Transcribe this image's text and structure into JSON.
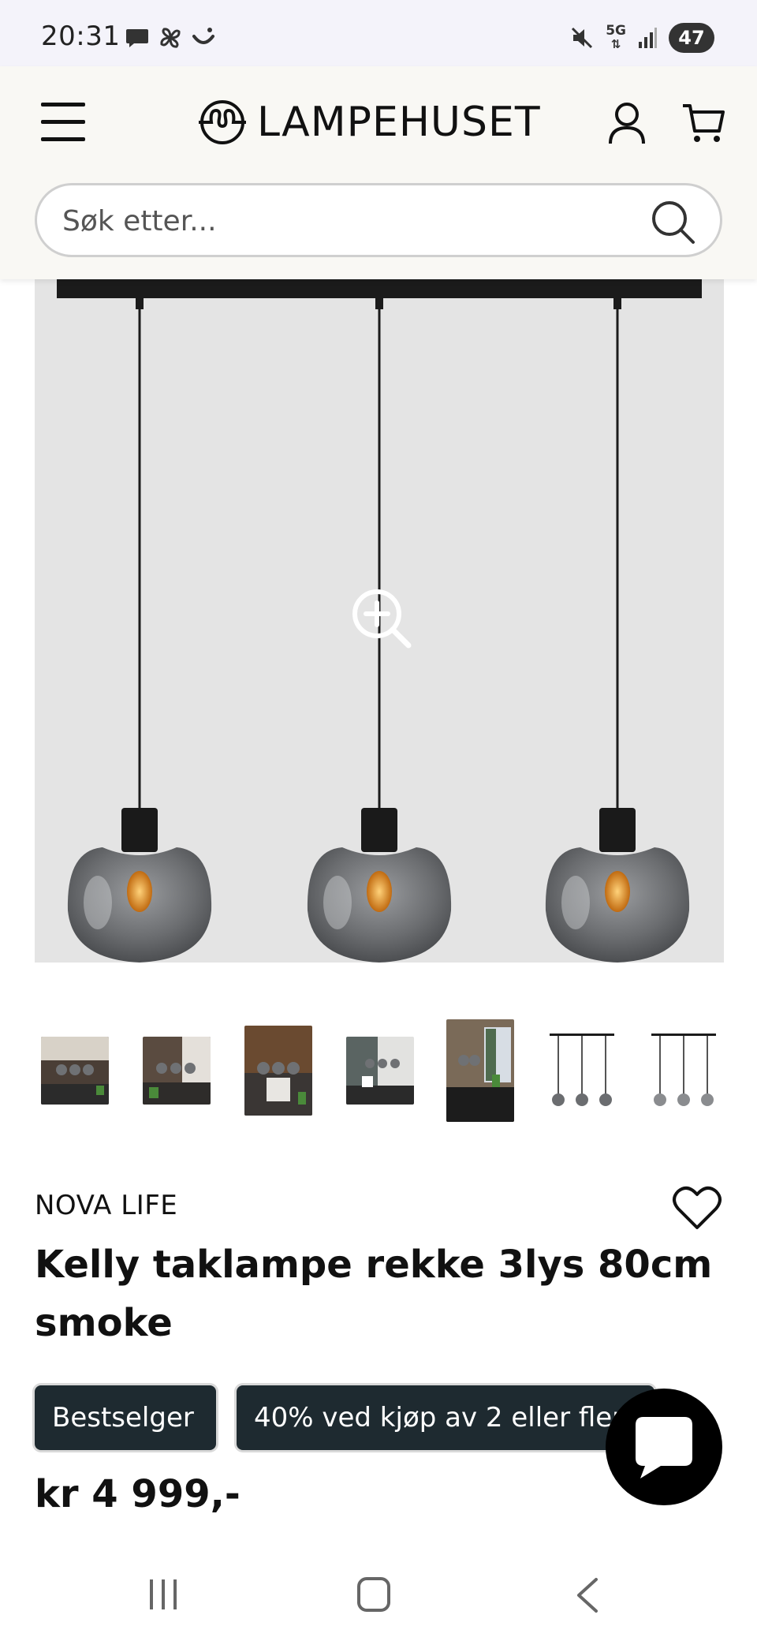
{
  "status_bar": {
    "time": "20:31",
    "left_icons": [
      "chat-bubble-icon",
      "pinwheel-icon",
      "smile-icon"
    ],
    "right_icons": [
      "mute-icon",
      "5g-icon",
      "signal-icon"
    ],
    "network_label": "5G",
    "battery": "47"
  },
  "header": {
    "brand": "LAMPEHUSET",
    "search": {
      "placeholder": "Søk etter..."
    },
    "icons": [
      "menu-icon",
      "logo-bulb-icon",
      "account-icon",
      "cart-icon",
      "search-icon"
    ]
  },
  "product": {
    "brand": "NOVA LIFE",
    "title": "Kelly taklampe rekke 3lys 80cm smoke",
    "badges": [
      "Bestselger",
      "40% ved kjøp av 2 eller flere"
    ],
    "price": "kr 4 999,-"
  },
  "gallery": {
    "image_count": 7,
    "selected_index": 4
  },
  "colors": {
    "header_bg": "#f9f8f4",
    "badge_bg": "#1e2a30",
    "image_bg": "#e4e4e4",
    "shade_smoke": "#6b6d70"
  },
  "nav_bar": {
    "icons": [
      "recent-apps-icon",
      "home-icon",
      "back-icon"
    ]
  }
}
